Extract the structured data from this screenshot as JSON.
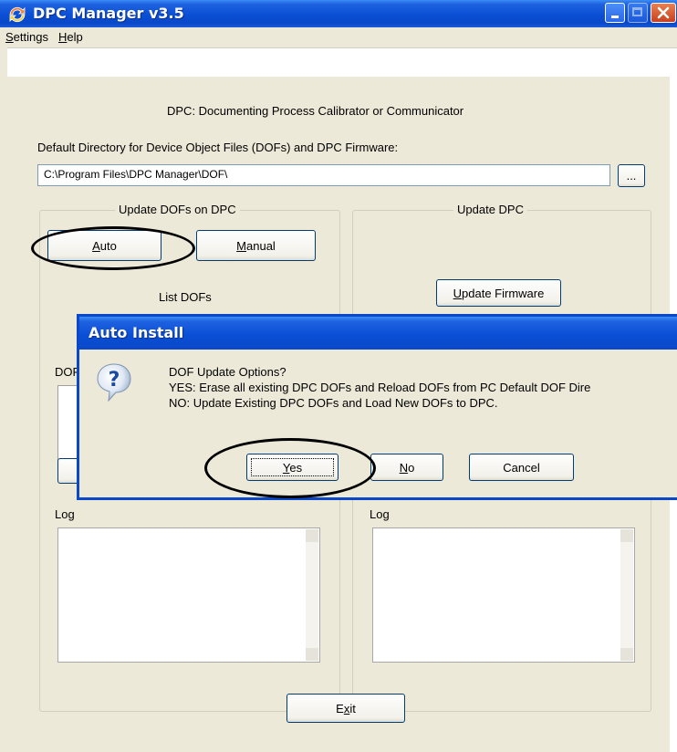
{
  "window": {
    "title": "DPC Manager v3.5",
    "controls": [
      "minimize",
      "maximize",
      "close"
    ]
  },
  "menubar": {
    "items": [
      {
        "label": "Settings",
        "mnemonic": "S",
        "rest": "ettings"
      },
      {
        "label": "Help",
        "mnemonic": "H",
        "rest": "elp"
      }
    ]
  },
  "main": {
    "description": "DPC: Documenting Process Calibrator or Communicator",
    "default_dir_label": "Default Directory for Device Object Files (DOFs) and DPC Firmware:",
    "default_dir_value": "C:\\Program Files\\DPC Manager\\DOF\\",
    "browse_label": "...",
    "left_group": {
      "title": "Update DOFs on DPC",
      "auto": {
        "mnemonic": "A",
        "rest": "uto"
      },
      "manual": {
        "mnemonic": "M",
        "rest": "anual"
      },
      "list_dofs": "List DOFs",
      "dof_label": "DOF",
      "log_label": "Log"
    },
    "right_group": {
      "title": "Update DPC",
      "update_firmware": {
        "mnemonic": "U",
        "rest": "pdate Firmware"
      },
      "log_label": "Log"
    },
    "exit": {
      "pre": "E",
      "mnemonic": "x",
      "rest": "it"
    }
  },
  "dialog": {
    "title": "Auto Install",
    "message_lines": [
      "DOF Update Options?",
      "YES: Erase all existing DPC DOFs and Reload DOFs from PC Default DOF Dire",
      "NO: Update Existing DPC DOFs and Load New DOFs to DPC."
    ],
    "yes": {
      "mnemonic": "Y",
      "rest": "es"
    },
    "no": {
      "mnemonic": "N",
      "rest": "o"
    },
    "cancel": "Cancel"
  },
  "colors": {
    "titlebar": "#0a48c8",
    "face": "#ece9d8",
    "button_border": "#003c74",
    "close_button": "#d04a25"
  }
}
